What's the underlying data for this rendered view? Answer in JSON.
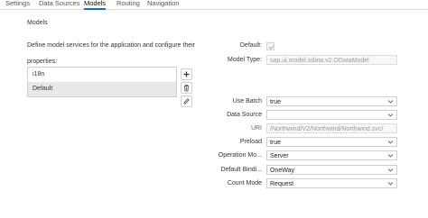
{
  "tabs": [
    {
      "label": "Settings",
      "active": false
    },
    {
      "label": "Data Sources",
      "active": false
    },
    {
      "label": "Models",
      "active": true
    },
    {
      "label": "Routing",
      "active": false
    },
    {
      "label": "Navigation",
      "active": false
    }
  ],
  "section": {
    "title": "Models",
    "description": "Define model services for the application and configure their properties:"
  },
  "models_list": {
    "items": [
      "i18n",
      "Default"
    ],
    "selected": "Default"
  },
  "list_actions": {
    "add_icon": "plus-icon",
    "delete_icon": "trash-icon",
    "edit_icon": "pencil-icon"
  },
  "form": {
    "default": {
      "label": "Default:",
      "checked": true
    },
    "model_type": {
      "label": "Model Type:",
      "value": "sap.ui.model.odata.v2.ODataModel"
    },
    "use_batch": {
      "label": "Use Batch",
      "value": "true"
    },
    "data_source": {
      "label": "Data Source",
      "value": ""
    },
    "uri": {
      "label": "URI",
      "value": "/Northwind/V2/Northwind/Northwind.svc/"
    },
    "preload": {
      "label": "Preload",
      "value": "true"
    },
    "operation_mode": {
      "label": "Operation Mo...",
      "value": "Server"
    },
    "default_binding": {
      "label": "Default Bindi...",
      "value": "OneWay"
    },
    "count_mode": {
      "label": "Count Mode",
      "value": "Request"
    }
  },
  "colors": {
    "accent": "#0a6ed1",
    "border": "#cfcfcf",
    "selected_row": "#e8e8e8"
  }
}
